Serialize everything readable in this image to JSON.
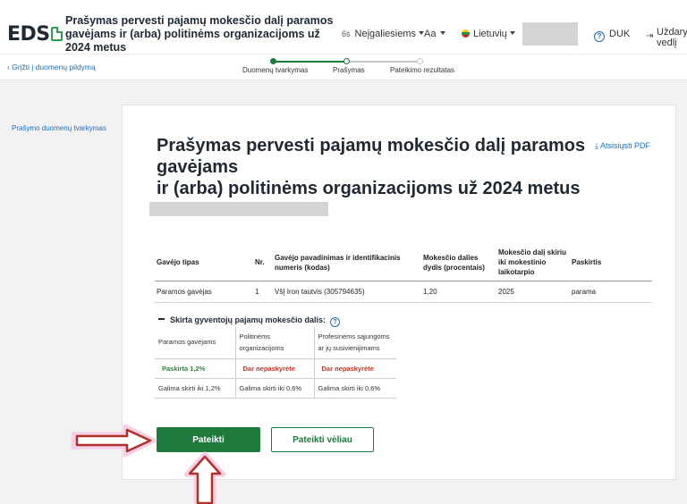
{
  "header": {
    "logo_text": "EDS",
    "title": "Prašymas pervesti pajamų mokesčio dalį paramos gavėjams ir (arba) politinėms organizacijoms už 2024 metus",
    "accessibility_icon_text": "6ś",
    "accessibility_label": "Neįgaliesiems",
    "font_size_label": "Aa",
    "language_label": "Lietuvių",
    "help_label": "DUK",
    "close_label": "Uždaryti vedlį"
  },
  "subnav": {
    "back_link": "Grįžti į duomenų pildymą",
    "steps": [
      {
        "label": "Duomenų tvarkymas",
        "state": "done"
      },
      {
        "label": "Prašymas",
        "state": "current"
      },
      {
        "label": "Pateikimo rezultatas",
        "state": "todo"
      }
    ]
  },
  "leftnav": {
    "link": "Prašymo duomenų tvarkymas"
  },
  "document": {
    "title_line1": "Prašymas pervesti pajamų mokesčio dalį paramos gavėjams",
    "title_line2": "ir (arba) politinėms organizacijoms už 2024 metus",
    "download_label": "Atsisiųsti PDF"
  },
  "main_table": {
    "headers": [
      "Gavėjo tipas",
      "Nr.",
      "Gavėjo pavadinimas ir identifikacinis numeris (kodas)",
      "Mokesčio dalies dydis (procentais)",
      "Mokesčio dalį skiriu iki mokestinio laikotarpio",
      "Paskirtis"
    ],
    "rows": [
      [
        "Paramos gavėjas",
        "1",
        "VšĮ Iron tautvis (305794635)",
        "1,20",
        "2025",
        "parama"
      ]
    ]
  },
  "split_section": {
    "heading": "Skirta gyventojų pajamų mokesčio dalis:",
    "columns": [
      "Paramos gavėjams",
      "Politinėms organizacijoms",
      "Profesinėms sąjungoms ar jų susivienijimams"
    ],
    "status": [
      "Paskirta 1,2%",
      "Dar nepaskyrėte",
      "Dar nepaskyrėte"
    ],
    "limits": [
      "Galima skirti iki 1,2%",
      "Galima skirti iki 0,6%",
      "Galima skirti iki 0,6%"
    ]
  },
  "actions": {
    "submit_label": "Pateikti",
    "submit_later_label": "Pateikti vėliau"
  },
  "colors": {
    "primary_green": "#1e7a3c",
    "link_blue": "#1c6fb8",
    "annotation_red": "#b0312a",
    "annotation_pink": "#f6cfe6"
  }
}
